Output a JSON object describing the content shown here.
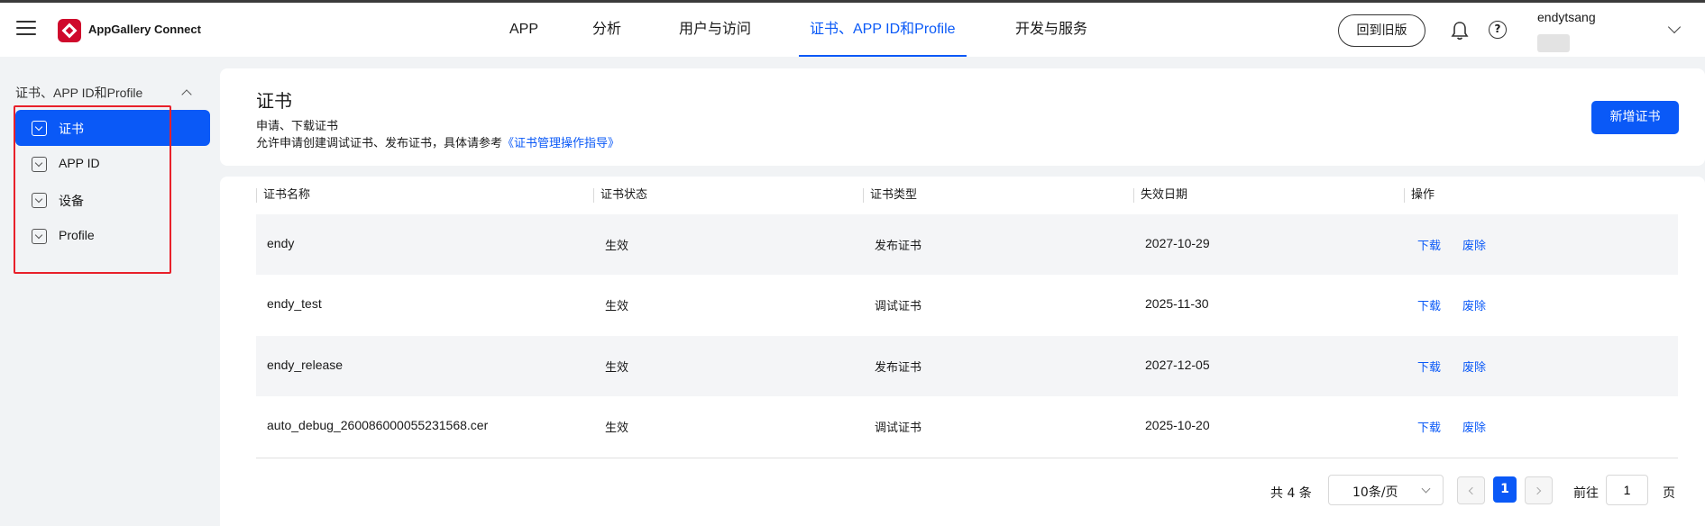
{
  "header": {
    "app_name": "AppGallery Connect",
    "nav": [
      {
        "label": "APP"
      },
      {
        "label": "分析"
      },
      {
        "label": "用户与访问"
      },
      {
        "label": "证书、APP ID和Profile"
      },
      {
        "label": "开发与服务"
      }
    ],
    "active_nav": "证书、APP ID和Profile",
    "old_version_label": "回到旧版",
    "username": "endytsang"
  },
  "sidebar": {
    "group_label": "证书、APP ID和Profile",
    "items": [
      {
        "label": "证书",
        "active": true
      },
      {
        "label": "APP ID",
        "active": false
      },
      {
        "label": "设备",
        "active": false
      },
      {
        "label": "Profile",
        "active": false
      }
    ]
  },
  "info": {
    "title": "证书",
    "subtitle": "申请、下载证书",
    "desc_prefix": "允许申请创建调试证书、发布证书，具体请参考",
    "desc_link": "《证书管理操作指导》",
    "add_button": "新增证书"
  },
  "table": {
    "columns": [
      "证书名称",
      "证书状态",
      "证书类型",
      "失效日期",
      "操作"
    ],
    "rows": [
      {
        "name": "endy",
        "status": "生效",
        "type": "发布证书",
        "expiry": "2027-10-29",
        "download": "下载",
        "revoke": "废除"
      },
      {
        "name": "endy_test",
        "status": "生效",
        "type": "调试证书",
        "expiry": "2025-11-30",
        "download": "下载",
        "revoke": "废除"
      },
      {
        "name": "endy_release",
        "status": "生效",
        "type": "发布证书",
        "expiry": "2027-12-05",
        "download": "下载",
        "revoke": "废除"
      },
      {
        "name": "auto_debug_260086000055231568.cer",
        "status": "生效",
        "type": "调试证书",
        "expiry": "2025-10-20",
        "download": "下载",
        "revoke": "废除"
      }
    ]
  },
  "pagination": {
    "total_text": "共 4 条",
    "page_size": "10条/页",
    "current_page": "1",
    "goto_label": "前往",
    "goto_value": "1",
    "goto_suffix": "页"
  },
  "colors": {
    "accent": "#0a59f7",
    "highlight_box": "#e8202a"
  }
}
